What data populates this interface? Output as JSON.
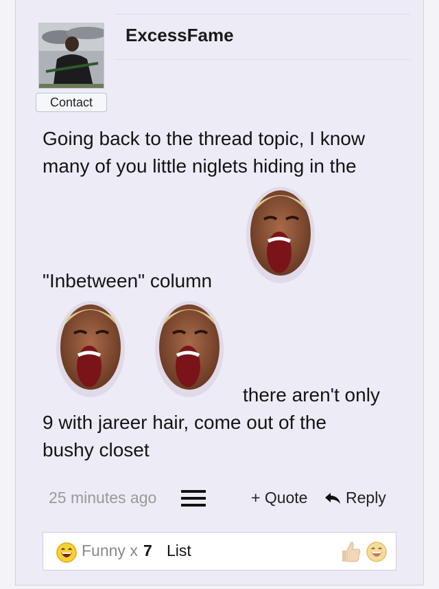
{
  "post": {
    "username": "ExcessFame",
    "contact_label": "Contact",
    "message_lines": [
      "Going back to the thread topic, I know",
      "many of you little niglets hiding in the",
      "\"Inbetween\" column",
      "there aren't only",
      "9 with jareer hair, come out of the",
      "bushy closet"
    ],
    "timestamp": "25 minutes ago",
    "quote_label": "+ Quote",
    "reply_label": "Reply"
  },
  "reactions": {
    "label": "Funny x",
    "count": "7",
    "list_label": "List"
  },
  "icons": [
    "user-avatar",
    "laughing-face-emoji",
    "menu-icon",
    "reply-arrow-icon",
    "funny-emoji-icon",
    "thumbs-up-icon"
  ]
}
